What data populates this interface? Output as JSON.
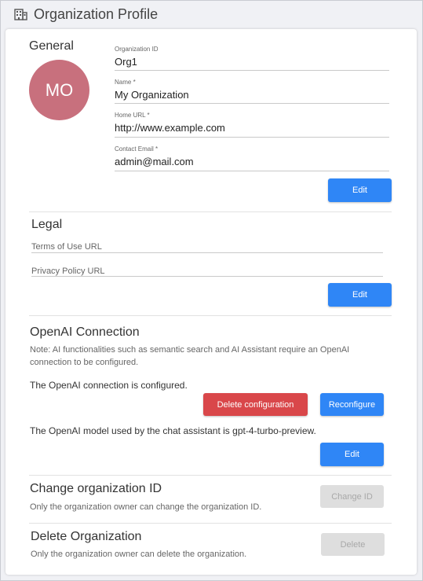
{
  "header": {
    "title": "Organization Profile",
    "icon": "building-icon"
  },
  "general": {
    "title": "General",
    "avatar_initials": "MO",
    "avatar_color": "#c8707d",
    "fields": [
      {
        "label": "Organization ID",
        "value": "Org1"
      },
      {
        "label": "Name *",
        "value": "My Organization"
      },
      {
        "label": "Home URL *",
        "value": "http://www.example.com"
      },
      {
        "label": "Contact Email *",
        "value": "admin@mail.com"
      }
    ],
    "edit_label": "Edit"
  },
  "legal": {
    "title": "Legal",
    "terms_label": "Terms of Use URL",
    "privacy_label": "Privacy Policy URL",
    "edit_label": "Edit"
  },
  "openai": {
    "title": "OpenAI Connection",
    "note": "Note: AI functionalities such as semantic search and AI Assistant require an OpenAI connection to be configured.",
    "status": "The OpenAI connection is configured.",
    "delete_label": "Delete configuration",
    "reconfigure_label": "Reconfigure",
    "model_text": "The OpenAI model used by the chat assistant is gpt-4-turbo-preview.",
    "edit_label": "Edit"
  },
  "change_id": {
    "title": "Change organization ID",
    "desc": "Only the organization owner can change the organization ID.",
    "button_label": "Change ID"
  },
  "delete_org": {
    "title": "Delete Organization",
    "desc": "Only the organization owner can delete the organization.",
    "button_label": "Delete"
  },
  "colors": {
    "primary": "#2f86f6",
    "danger": "#d9474a",
    "disabled": "#dedede"
  }
}
